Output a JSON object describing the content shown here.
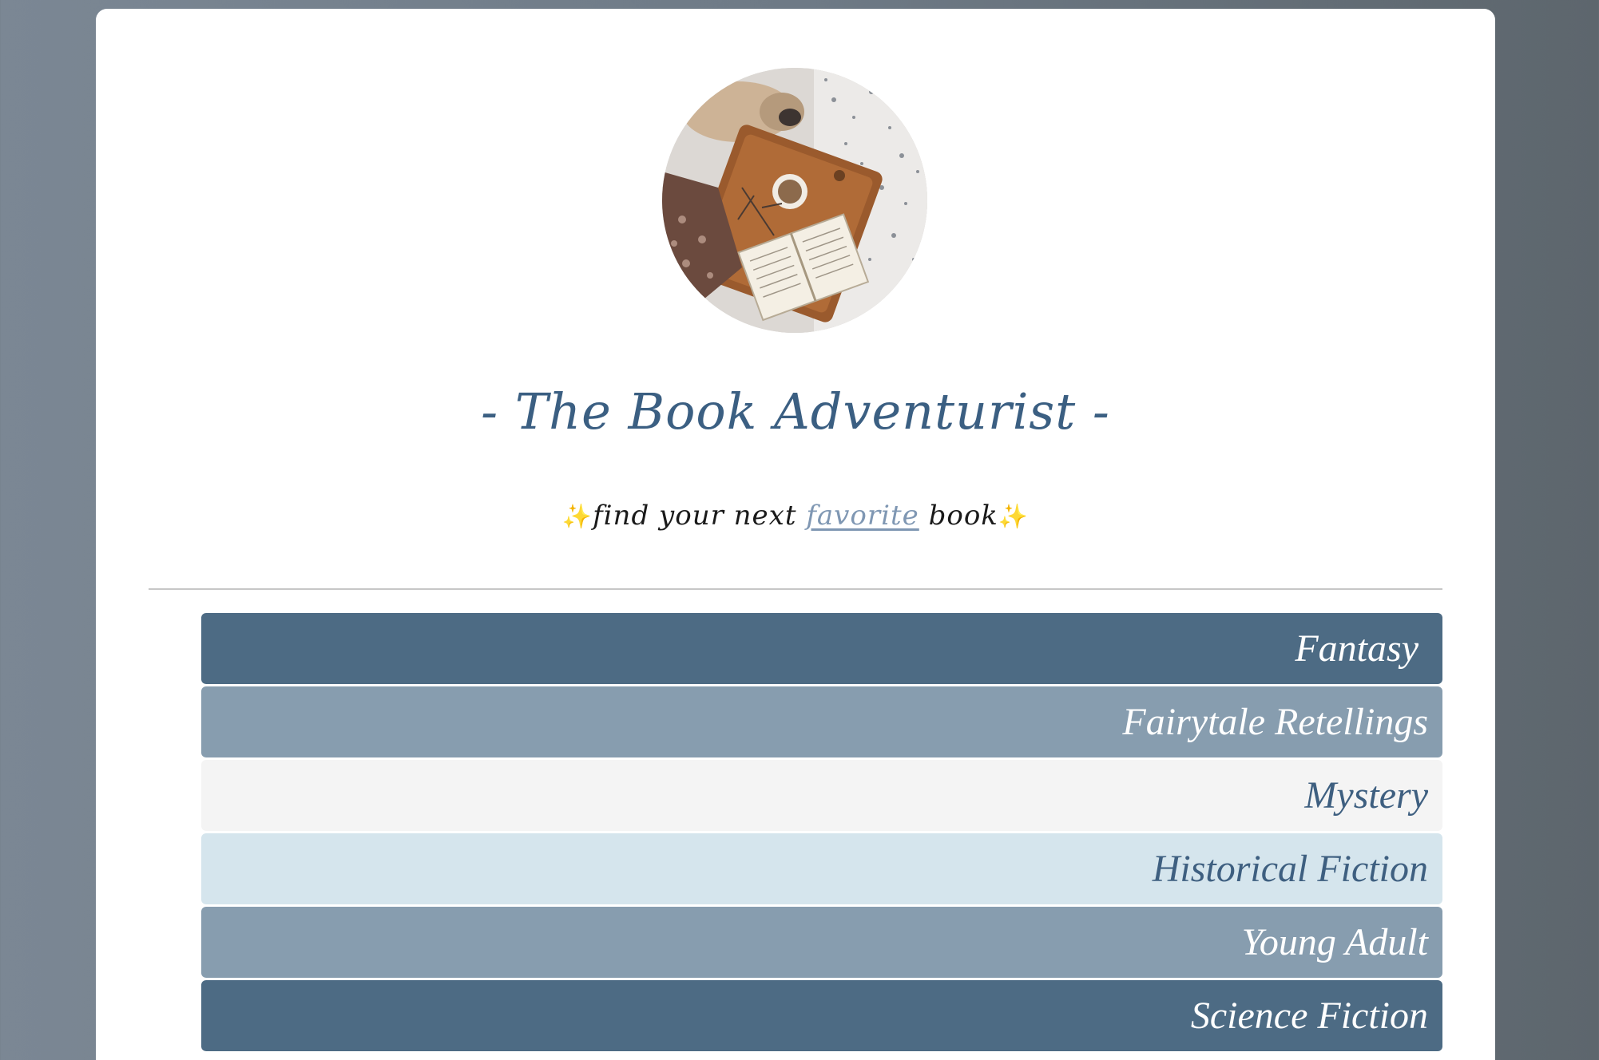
{
  "header": {
    "title": "- The Book Adventurist -",
    "tagline_start": "find your next ",
    "tagline_link": "favorite",
    "tagline_end": " book",
    "sparkle_left": "✨",
    "sparkle_right": "✨"
  },
  "genres": [
    {
      "label": "Fantasy",
      "color": "#4d6b84"
    },
    {
      "label": "Fairytale Retellings",
      "color": "#879daf"
    },
    {
      "label": "Mystery",
      "color": "#f4f4f4"
    },
    {
      "label": "Historical Fiction",
      "color": "#d5e5ed"
    },
    {
      "label": "Young Adult",
      "color": "#879daf"
    },
    {
      "label": "Science Fiction",
      "color": "#4d6b84"
    }
  ],
  "colors": {
    "accent": "#3b5f82",
    "link": "#7f97b3",
    "background": "#6e7a86"
  }
}
